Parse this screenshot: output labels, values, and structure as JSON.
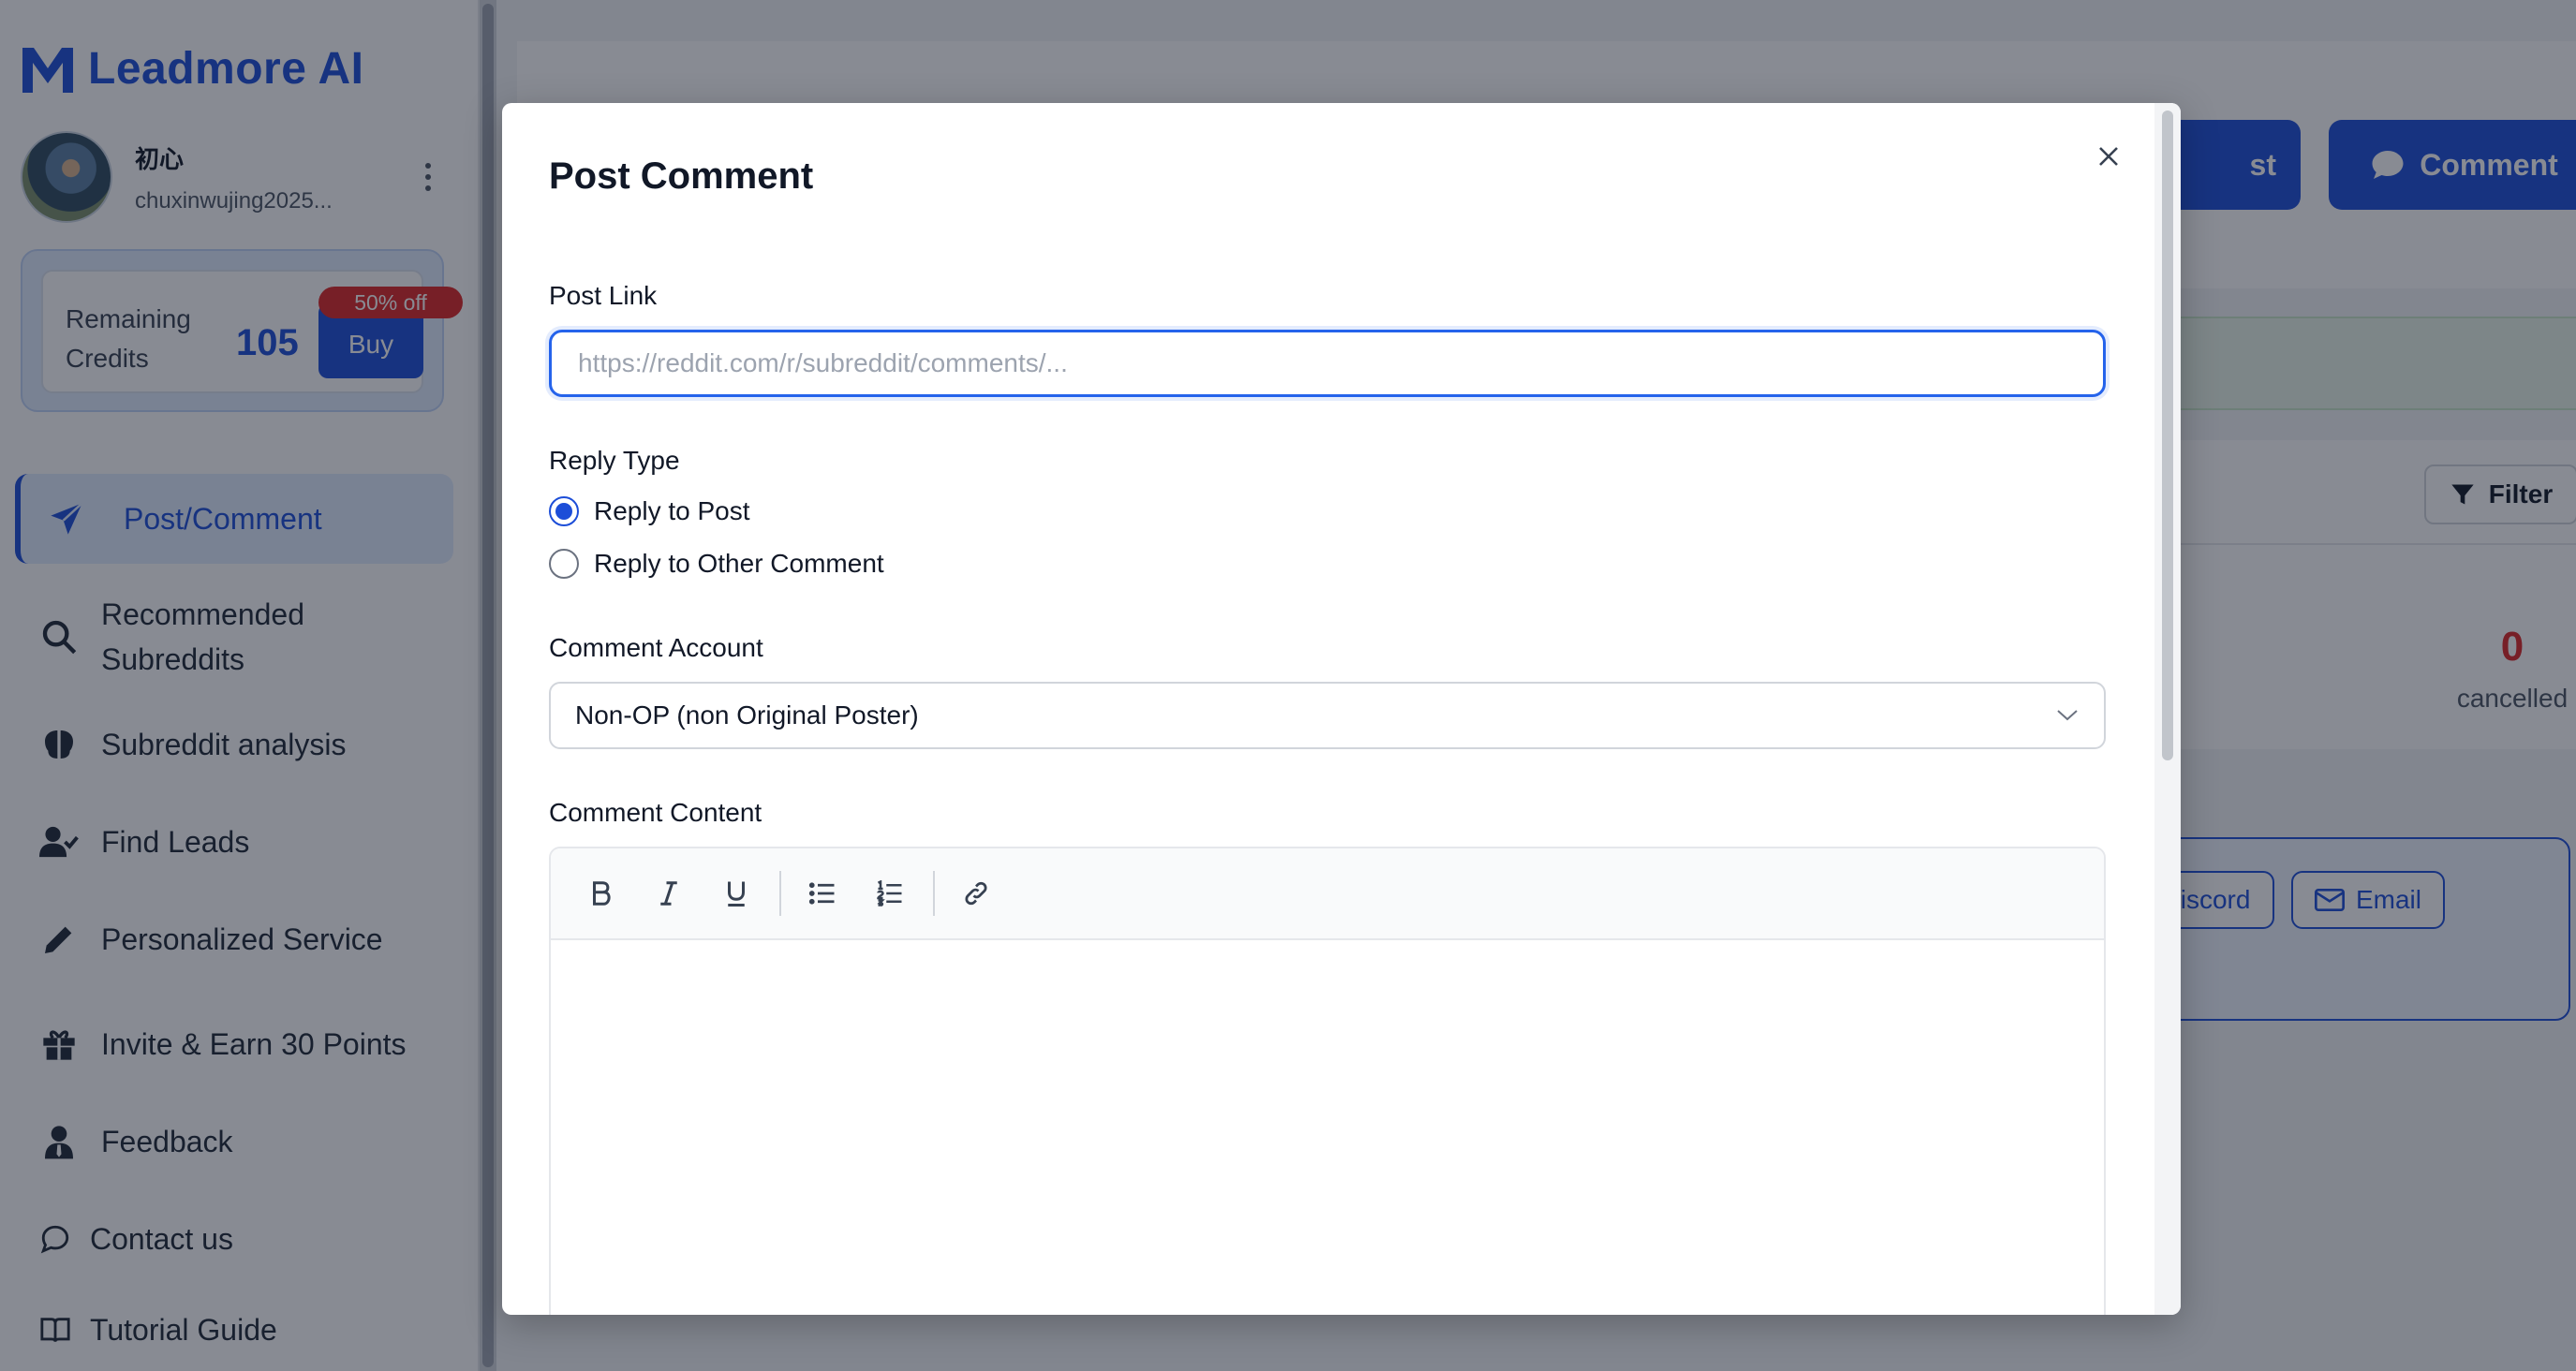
{
  "sidebar": {
    "brand": "Leadmore AI",
    "user": {
      "name": "初心",
      "email": "chuxinwujing2025..."
    },
    "credits": {
      "label": "Remaining Credits",
      "value": "105",
      "buy_label": "Buy",
      "discount": "50% off"
    },
    "nav": [
      {
        "label": "Post/Comment",
        "icon": "paper-plane-icon",
        "active": true
      },
      {
        "label": "Recommended Subreddits",
        "icon": "search-icon"
      },
      {
        "label": "Subreddit analysis",
        "icon": "brain-icon"
      },
      {
        "label": "Find Leads",
        "icon": "user-check-icon"
      },
      {
        "label": "Personalized Service",
        "icon": "pen-icon"
      },
      {
        "label": "Invite & Earn 30 Points",
        "icon": "gift-icon"
      },
      {
        "label": "Feedback",
        "icon": "user-tie-icon"
      },
      {
        "label": "Contact us",
        "icon": "chat-bubble-icon"
      },
      {
        "label": "Tutorial Guide",
        "icon": "book-icon"
      }
    ]
  },
  "background": {
    "post_button_partial": "st",
    "comment_button": "Comment",
    "filter_button": "Filter",
    "cancelled_count": "0",
    "cancelled_label": "cancelled",
    "discord_button": "Discord",
    "email_button": "Email"
  },
  "modal": {
    "title": "Post Comment",
    "post_link_label": "Post Link",
    "post_link_placeholder": "https://reddit.com/r/subreddit/comments/...",
    "reply_type_label": "Reply Type",
    "reply_options": [
      {
        "label": "Reply to Post",
        "checked": true
      },
      {
        "label": "Reply to Other Comment",
        "checked": false
      }
    ],
    "comment_account_label": "Comment Account",
    "comment_account_value": "Non-OP (non Original Poster)",
    "comment_content_label": "Comment Content",
    "toolbar": [
      "bold-icon",
      "italic-icon",
      "underline-icon",
      "bullet-list-icon",
      "numbered-list-icon",
      "link-icon"
    ]
  },
  "colors": {
    "accent": "#1d4ed8",
    "danger": "#dc2626",
    "overlay": "rgba(17,24,39,0.5)"
  }
}
